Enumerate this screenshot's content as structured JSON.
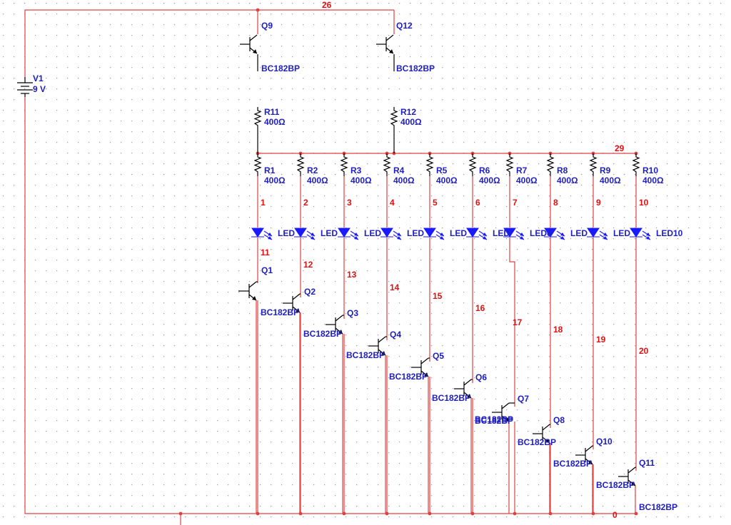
{
  "colors": {
    "wire": "#e04040",
    "component": "#000000",
    "label": "#2020c0",
    "net": "#dd1111",
    "led": "#1a1aff",
    "grid": "#9a9a9a"
  },
  "source": {
    "name": "V1",
    "value": "9 V"
  },
  "upper_transistors": [
    {
      "name": "Q9",
      "model": "BC182BP"
    },
    {
      "name": "Q12",
      "model": "BC182BP"
    }
  ],
  "upper_resistors": [
    {
      "name": "R11",
      "value": "400Ω"
    },
    {
      "name": "R12",
      "value": "400Ω"
    }
  ],
  "resistors": [
    {
      "name": "R1",
      "value": "400Ω"
    },
    {
      "name": "R2",
      "value": "400Ω"
    },
    {
      "name": "R3",
      "value": "400Ω"
    },
    {
      "name": "R4",
      "value": "400Ω"
    },
    {
      "name": "R5",
      "value": "400Ω"
    },
    {
      "name": "R6",
      "value": "400Ω"
    },
    {
      "name": "R7",
      "value": "400Ω"
    },
    {
      "name": "R8",
      "value": "400Ω"
    },
    {
      "name": "R9",
      "value": "400Ω"
    },
    {
      "name": "R10",
      "value": "400Ω"
    }
  ],
  "led_labels": [
    "LED",
    "LED",
    "LED",
    "LED",
    "LED",
    "LED",
    "LED6",
    "LED",
    "LED",
    "LED10"
  ],
  "nets_top": [
    "1",
    "2",
    "3",
    "4",
    "5",
    "6",
    "7",
    "8",
    "9",
    "10"
  ],
  "nets_mid": [
    "11",
    "12",
    "13",
    "14",
    "15",
    "16",
    "17",
    "18",
    "19",
    "20"
  ],
  "transistors": [
    {
      "name": "Q1",
      "model": "BC182BP"
    },
    {
      "name": "Q2",
      "model": "BC182BP"
    },
    {
      "name": "Q3",
      "model": "BC182BP"
    },
    {
      "name": "Q4",
      "model": "BC182BP"
    },
    {
      "name": "Q5",
      "model": "BC182BP"
    },
    {
      "name": "Q6",
      "model": "BC182BP"
    },
    {
      "name": "Q7",
      "model": "BC182BP"
    },
    {
      "name": "Q8",
      "model": "BC182BP"
    },
    {
      "name": "Q10",
      "model": "BC182BP"
    },
    {
      "name": "Q11",
      "model": "BC182BP"
    }
  ],
  "net_supply": "26",
  "net_bus": "29",
  "net_ground": "0"
}
